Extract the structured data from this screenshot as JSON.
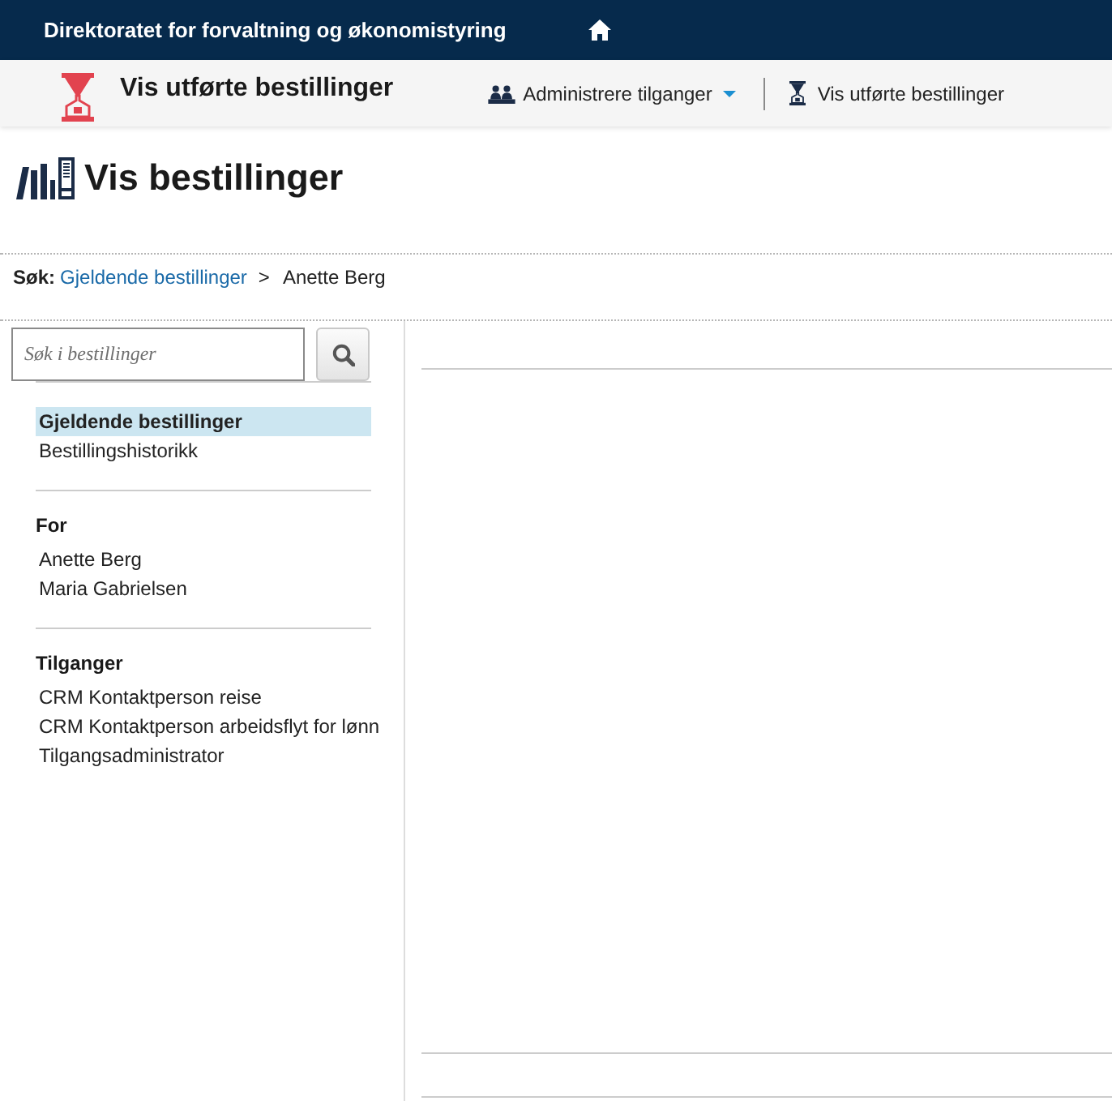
{
  "header": {
    "title": "Direktoratet for forvaltning og økonomistyring"
  },
  "app_bar": {
    "title": "Vis utførte bestillinger",
    "nav": [
      {
        "kind": "dropdown",
        "label": "Administrere tilganger"
      },
      {
        "kind": "link",
        "label": "Vis utførte bestillinger"
      }
    ]
  },
  "page": {
    "title": "Vis bestillinger"
  },
  "breadcrumb": {
    "label": "Søk:",
    "separator": ">",
    "items": [
      {
        "kind": "link",
        "label": "Gjeldende bestillinger"
      },
      {
        "kind": "current",
        "label": "Anette Berg"
      }
    ]
  },
  "search": {
    "placeholder": "Søk i bestillinger"
  },
  "sidebar": {
    "groups": [
      {
        "items": [
          {
            "label": "Gjeldende bestillinger",
            "selected": true
          },
          {
            "label": "Bestillingshistorikk",
            "selected": false
          }
        ]
      },
      {
        "heading": "For",
        "items": [
          {
            "label": "Anette Berg",
            "selected": false
          },
          {
            "label": "Maria Gabrielsen",
            "selected": false
          }
        ]
      },
      {
        "heading": "Tilganger",
        "items": [
          {
            "label": "CRM Kontaktperson reise",
            "selected": false
          },
          {
            "label": "CRM Kontaktperson arbeidsflyt for lønn",
            "selected": false
          },
          {
            "label": "Tilgangsadministrator",
            "selected": false
          }
        ]
      }
    ]
  }
}
